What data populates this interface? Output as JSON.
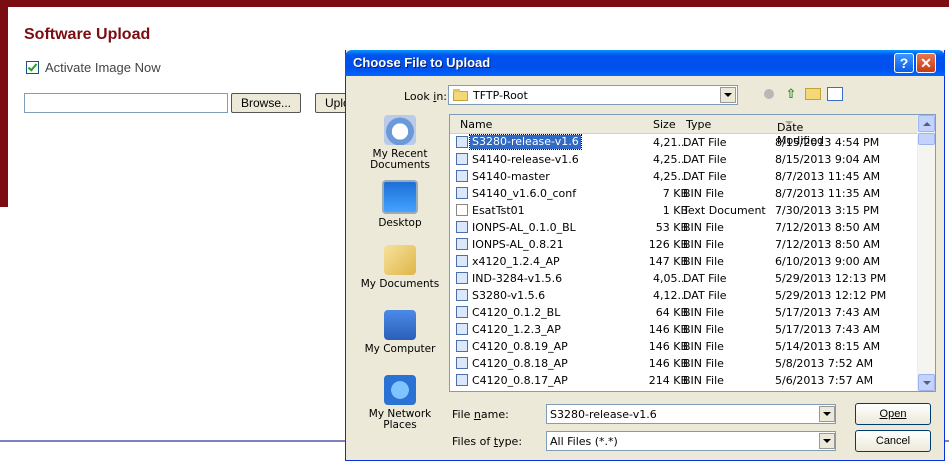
{
  "page": {
    "title": "Software Upload",
    "activate_label": "Activate Image Now",
    "browse_label": "Browse...",
    "upload_label": "Upload"
  },
  "dialog": {
    "title": "Choose File to Upload",
    "help_label": "?",
    "close_label": "✕",
    "look_in_label": "Look in:",
    "look_in_value": "TFTP-Root",
    "places": [
      "My Recent Documents",
      "Desktop",
      "My Documents",
      "My Computer",
      "My Network Places"
    ],
    "columns": {
      "name": "Name",
      "size": "Size",
      "type": "Type",
      "date": "Date Modified"
    },
    "files": [
      {
        "name": "S3280-release-v1.6",
        "size": "4,21...",
        "type": "DAT File",
        "date": "8/15/2013 4:54 PM",
        "selected": true,
        "icon": "dat-file-icon"
      },
      {
        "name": "S4140-release-v1.6",
        "size": "4,25...",
        "type": "DAT File",
        "date": "8/15/2013 9:04 AM",
        "icon": "dat-file-icon"
      },
      {
        "name": "S4140-master",
        "size": "4,25...",
        "type": "DAT File",
        "date": "8/7/2013 11:45 AM",
        "icon": "dat-file-icon"
      },
      {
        "name": "S4140_v1.6.0_conf",
        "size": "7 KB",
        "type": "BIN File",
        "date": "8/7/2013 11:35 AM",
        "icon": "bin-file-icon"
      },
      {
        "name": "EsatTst01",
        "size": "1 KB",
        "type": "Text Document",
        "date": "7/30/2013 3:15 PM",
        "icon": "text-file-icon"
      },
      {
        "name": "IONPS-AL_0.1.0_BL",
        "size": "53 KB",
        "type": "BIN File",
        "date": "7/12/2013 8:50 AM",
        "icon": "bin-file-icon"
      },
      {
        "name": "IONPS-AL_0.8.21",
        "size": "126 KB",
        "type": "BIN File",
        "date": "7/12/2013 8:50 AM",
        "icon": "bin-file-icon"
      },
      {
        "name": "x4120_1.2.4_AP",
        "size": "147 KB",
        "type": "BIN File",
        "date": "6/10/2013 9:00 AM",
        "icon": "bin-file-icon"
      },
      {
        "name": "IND-3284-v1.5.6",
        "size": "4,05...",
        "type": "DAT File",
        "date": "5/29/2013 12:13 PM",
        "icon": "dat-file-icon"
      },
      {
        "name": "S3280-v1.5.6",
        "size": "4,12...",
        "type": "DAT File",
        "date": "5/29/2013 12:12 PM",
        "icon": "dat-file-icon"
      },
      {
        "name": "C4120_0.1.2_BL",
        "size": "64 KB",
        "type": "BIN File",
        "date": "5/17/2013 7:43 AM",
        "icon": "bin-file-icon"
      },
      {
        "name": "C4120_1.2.3_AP",
        "size": "146 KB",
        "type": "BIN File",
        "date": "5/17/2013 7:43 AM",
        "icon": "bin-file-icon"
      },
      {
        "name": "C4120_0.8.19_AP",
        "size": "146 KB",
        "type": "BIN File",
        "date": "5/14/2013 8:15 AM",
        "icon": "bin-file-icon"
      },
      {
        "name": "C4120_0.8.18_AP",
        "size": "146 KB",
        "type": "BIN File",
        "date": "5/8/2013 7:52 AM",
        "icon": "bin-file-icon"
      },
      {
        "name": "C4120_0.8.17_AP",
        "size": "214 KB",
        "type": "BIN File",
        "date": "5/6/2013 7:57 AM",
        "icon": "bin-file-icon"
      }
    ],
    "file_name_label": "File name:",
    "file_name_value": "S3280-release-v1.6",
    "file_type_label": "Files of type:",
    "file_type_value": "All Files (*.*)",
    "open_label": "Open",
    "cancel_label": "Cancel"
  }
}
